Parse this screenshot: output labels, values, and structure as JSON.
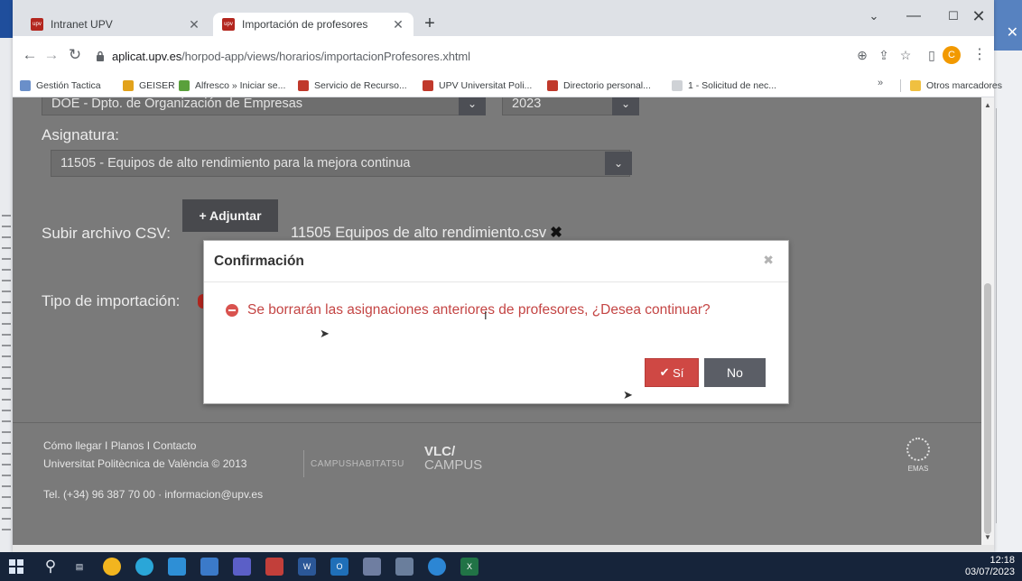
{
  "browser": {
    "tabs": [
      {
        "label": "Intranet UPV",
        "favicon": "upv"
      },
      {
        "label": "Importación de profesores",
        "favicon": "upv"
      }
    ],
    "url_host": "aplicat.upv.es",
    "url_path": "/horpod-app/views/horarios/importacionProfesores.xhtml",
    "profile_initial": "C",
    "bookmarks": [
      "Gestión Tactica",
      "GEISER",
      "Alfresco » Iniciar se...",
      "Servicio de Recurso...",
      "UPV Universitat Poli...",
      "Directorio personal...",
      "1 - Solicitud de nec..."
    ],
    "bookmarks_more": "»",
    "other_bookmarks": "Otros marcadores"
  },
  "form": {
    "department_value": "DOE - Dpto. de Organización de Empresas",
    "year_value": "2023",
    "subject_label": "Asignatura:",
    "subject_value": "11505 - Equipos de alto rendimiento para la mejora continua",
    "upload_label": "Subir archivo CSV:",
    "attach_button": "+ Adjuntar",
    "file_name": "11505 Equipos de alto rendimiento.csv",
    "import_type_label": "Tipo de importación:"
  },
  "footer": {
    "links": "Cómo llegar I Planos I Contacto",
    "copyright": "Universitat Politècnica de València © 2013",
    "contact": "Tel. (+34) 96 387 70 00 · informacion@upv.es",
    "campus_habitat": "CAMPUSHABITAT5U",
    "vlc_top": "VLC/",
    "vlc_bottom": "CAMPUS",
    "emas": "EMAS"
  },
  "dialog": {
    "title": "Confirmación",
    "message": "Se borrarán las asignaciones anteriores de profesores, ¿Desea continuar?",
    "yes_label": "Sí",
    "no_label": "No"
  },
  "taskbar": {
    "time": "12:18",
    "date": "03/07/2023"
  },
  "colors": {
    "danger": "#d9534f",
    "overlay": "#7a7a7a",
    "taskbar": "#16243a"
  }
}
